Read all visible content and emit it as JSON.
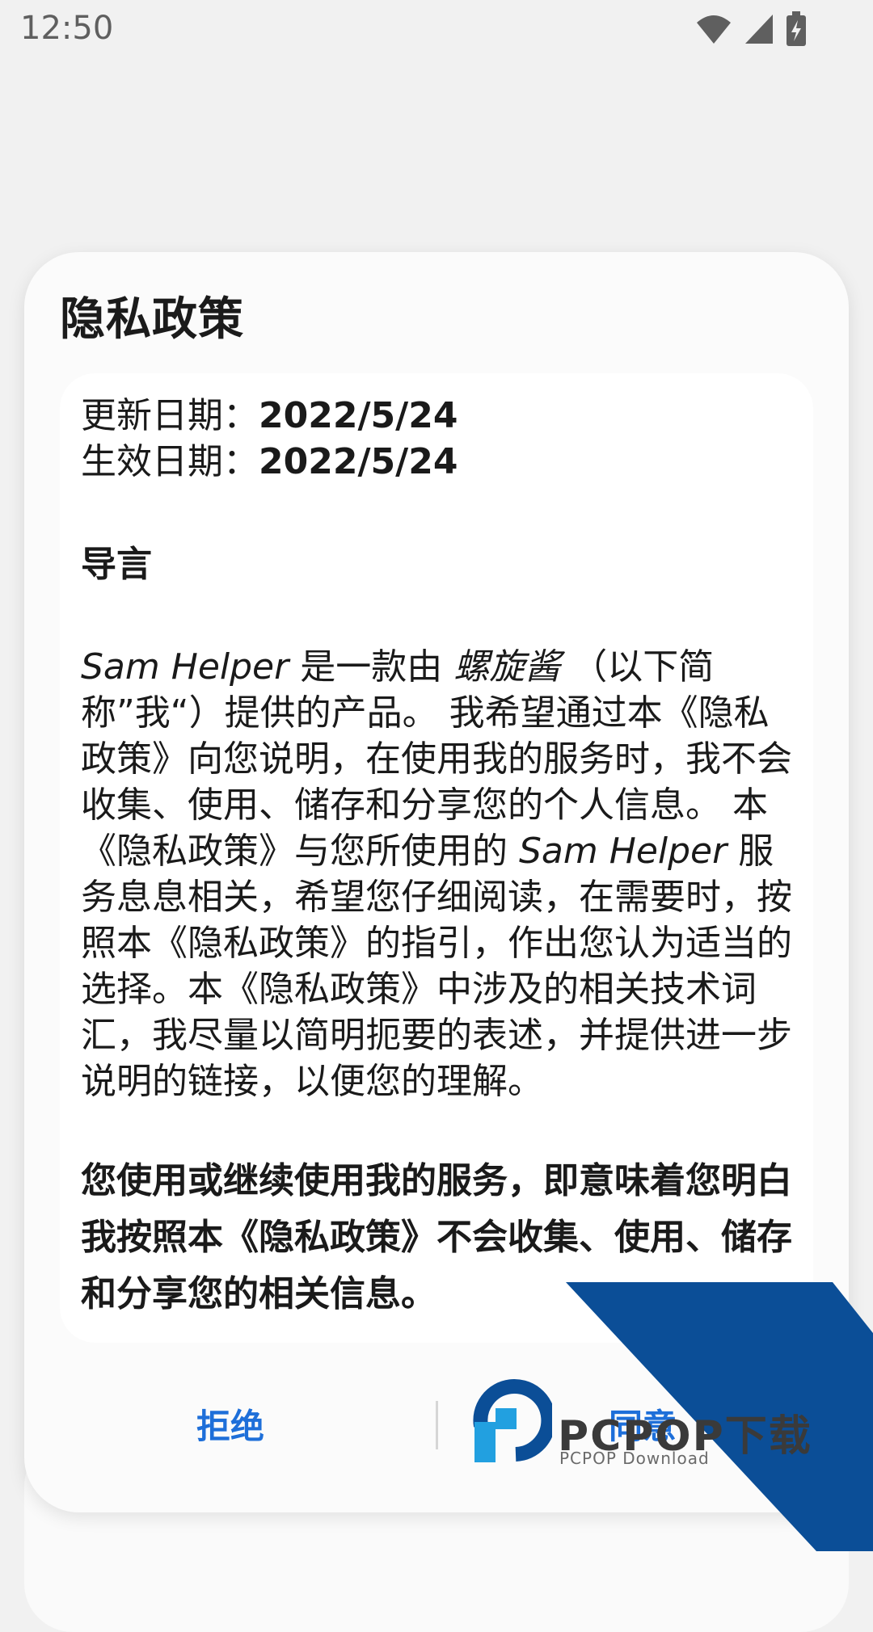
{
  "status_bar": {
    "time": "12:50",
    "icons": [
      "wifi-icon",
      "cell-signal-icon",
      "battery-charging-icon"
    ]
  },
  "dialog": {
    "title": "隐私政策",
    "update_label": "更新日期：",
    "update_date": "2022/5/24",
    "effective_label": "生效日期：",
    "effective_date": "2022/5/24",
    "section_heading": "导言",
    "intro": {
      "app_name": "Sam Helper",
      "part1": " 是一款由 ",
      "developer": "螺旋酱",
      "part2": " （以下简称”我“）提供的产品。 我希望通过本《隐私政策》向您说明，在使用我的服务时，我不会收集、使用、储存和分享您的个人信息。 本《隐私政策》与您所使用的 ",
      "app_name_2": "Sam Helper",
      "part3": " 服务息息相关，希望您仔细阅读，在需要时，按照本《隐私政策》的指引，作出您认为适当的选择。本《隐私政策》中涉及的相关技术词汇，我尽量以简明扼要的表述，并提供进一步说明的链接，以便您的理解。"
    },
    "bold_paragraph": "您使用或继续使用我的服务，即意味着您明白我按照本《隐私政策》不会收集、使用、储存和分享您的相关信息。",
    "reject_label": "拒绝",
    "agree_label": "同意"
  },
  "watermark": {
    "brand": "PCPOP下载",
    "sub": "PCPOP Download"
  },
  "colors": {
    "accent": "#1e6fd9",
    "watermark_blue": "#0b4e97",
    "watermark_cyan": "#22a0e0"
  }
}
